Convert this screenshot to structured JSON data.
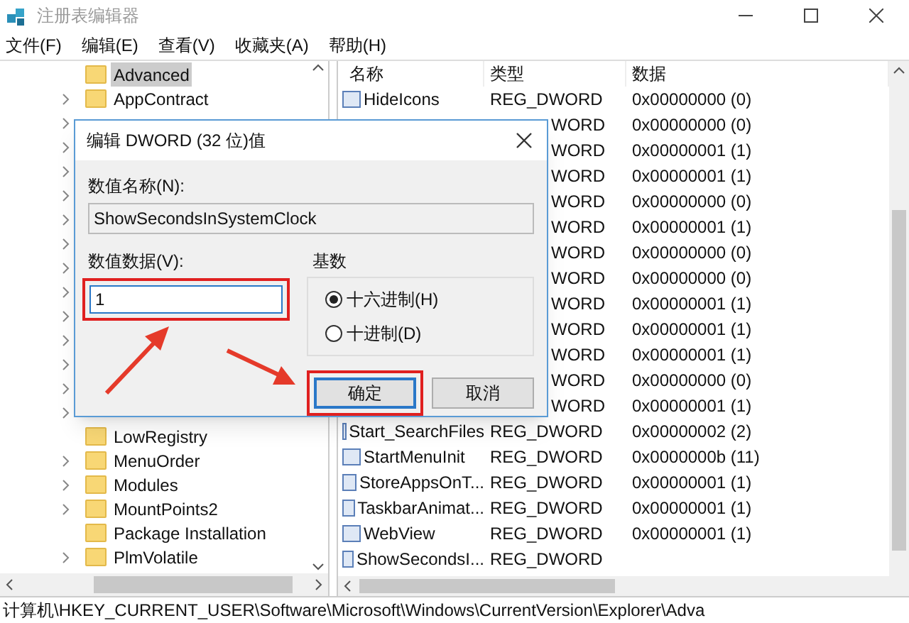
{
  "window": {
    "title": "注册表编辑器"
  },
  "menu": [
    "文件(F)",
    "编辑(E)",
    "查看(V)",
    "收藏夹(A)",
    "帮助(H)"
  ],
  "tree": [
    {
      "label": "Advanced",
      "expandable": false,
      "selected": true
    },
    {
      "label": "AppContract",
      "expandable": true,
      "selected": false
    },
    {
      "expandable": true
    },
    {
      "expandable": true
    },
    {
      "expandable": true
    },
    {
      "expandable": true
    },
    {
      "expandable": true
    },
    {
      "expandable": true
    },
    {
      "expandable": true
    },
    {
      "expandable": true
    },
    {
      "expandable": true
    },
    {
      "expandable": true
    },
    {
      "expandable": true
    },
    {
      "expandable": true
    },
    {
      "expandable": true
    },
    {
      "label": "LowRegistry",
      "expandable": false,
      "selected": false
    },
    {
      "label": "MenuOrder",
      "expandable": true,
      "selected": false
    },
    {
      "label": "Modules",
      "expandable": true,
      "selected": false
    },
    {
      "label": "MountPoints2",
      "expandable": true,
      "selected": false
    },
    {
      "label": "Package Installation",
      "expandable": false,
      "selected": false
    },
    {
      "label": "PlmVolatile",
      "expandable": true,
      "selected": false
    }
  ],
  "values": {
    "columns": [
      "名称",
      "类型",
      "数据"
    ],
    "rows": [
      {
        "name": "HideIcons",
        "type": "REG_DWORD",
        "data": "0x00000000 (0)"
      },
      {
        "type": "WORD",
        "data": "0x00000000 (0)"
      },
      {
        "type": "WORD",
        "data": "0x00000001 (1)"
      },
      {
        "type": "WORD",
        "data": "0x00000001 (1)"
      },
      {
        "type": "WORD",
        "data": "0x00000000 (0)"
      },
      {
        "type": "WORD",
        "data": "0x00000001 (1)"
      },
      {
        "type": "WORD",
        "data": "0x00000000 (0)"
      },
      {
        "type": "WORD",
        "data": "0x00000000 (0)"
      },
      {
        "type": "WORD",
        "data": "0x00000001 (1)"
      },
      {
        "type": "WORD",
        "data": "0x00000001 (1)"
      },
      {
        "type": "WORD",
        "data": "0x00000001 (1)"
      },
      {
        "type": "WORD",
        "data": "0x00000000 (0)"
      },
      {
        "type": "WORD",
        "data": "0x00000001 (1)"
      },
      {
        "name": "Start_SearchFiles",
        "type": "REG_DWORD",
        "data": "0x00000002 (2)"
      },
      {
        "name": "StartMenuInit",
        "type": "REG_DWORD",
        "data": "0x0000000b (11)"
      },
      {
        "name": "StoreAppsOnT...",
        "type": "REG_DWORD",
        "data": "0x00000001 (1)"
      },
      {
        "name": "TaskbarAnimat...",
        "type": "REG_DWORD",
        "data": "0x00000001 (1)"
      },
      {
        "name": "WebView",
        "type": "REG_DWORD",
        "data": "0x00000001 (1)"
      },
      {
        "name": "ShowSecondsI...",
        "type": "REG_DWORD"
      }
    ]
  },
  "status_bar": "计算机\\HKEY_CURRENT_USER\\Software\\Microsoft\\Windows\\CurrentVersion\\Explorer\\Adva",
  "dialog": {
    "title": "编辑 DWORD (32 位)值",
    "name_label": "数值名称(N):",
    "name_value": "ShowSecondsInSystemClock",
    "data_label": "数值数据(V):",
    "data_value": "1",
    "base_label": "基数",
    "radios": [
      {
        "label": "十六进制(H)",
        "selected": true
      },
      {
        "label": "十进制(D)",
        "selected": false
      }
    ],
    "ok": "确定",
    "cancel": "取消"
  }
}
